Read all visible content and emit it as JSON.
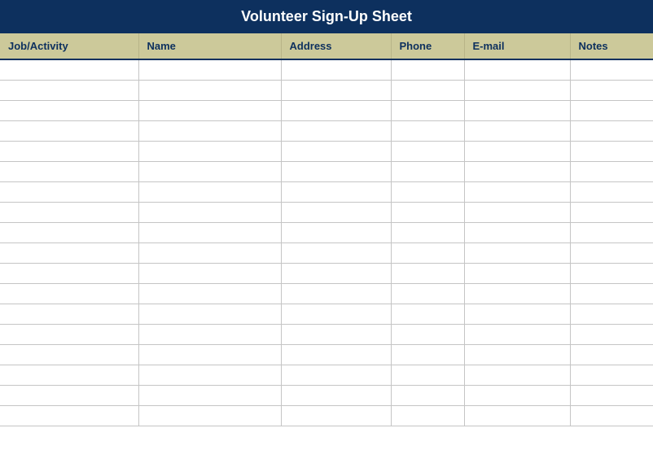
{
  "title": "Volunteer Sign-Up Sheet",
  "columns": [
    {
      "label": "Job/Activity"
    },
    {
      "label": "Name"
    },
    {
      "label": "Address"
    },
    {
      "label": "Phone"
    },
    {
      "label": "E-mail"
    },
    {
      "label": "Notes"
    }
  ],
  "rows": [
    [
      "",
      "",
      "",
      "",
      "",
      ""
    ],
    [
      "",
      "",
      "",
      "",
      "",
      ""
    ],
    [
      "",
      "",
      "",
      "",
      "",
      ""
    ],
    [
      "",
      "",
      "",
      "",
      "",
      ""
    ],
    [
      "",
      "",
      "",
      "",
      "",
      ""
    ],
    [
      "",
      "",
      "",
      "",
      "",
      ""
    ],
    [
      "",
      "",
      "",
      "",
      "",
      ""
    ],
    [
      "",
      "",
      "",
      "",
      "",
      ""
    ],
    [
      "",
      "",
      "",
      "",
      "",
      ""
    ],
    [
      "",
      "",
      "",
      "",
      "",
      ""
    ],
    [
      "",
      "",
      "",
      "",
      "",
      ""
    ],
    [
      "",
      "",
      "",
      "",
      "",
      ""
    ],
    [
      "",
      "",
      "",
      "",
      "",
      ""
    ],
    [
      "",
      "",
      "",
      "",
      "",
      ""
    ],
    [
      "",
      "",
      "",
      "",
      "",
      ""
    ],
    [
      "",
      "",
      "",
      "",
      "",
      ""
    ],
    [
      "",
      "",
      "",
      "",
      "",
      ""
    ],
    [
      "",
      "",
      "",
      "",
      "",
      ""
    ]
  ]
}
